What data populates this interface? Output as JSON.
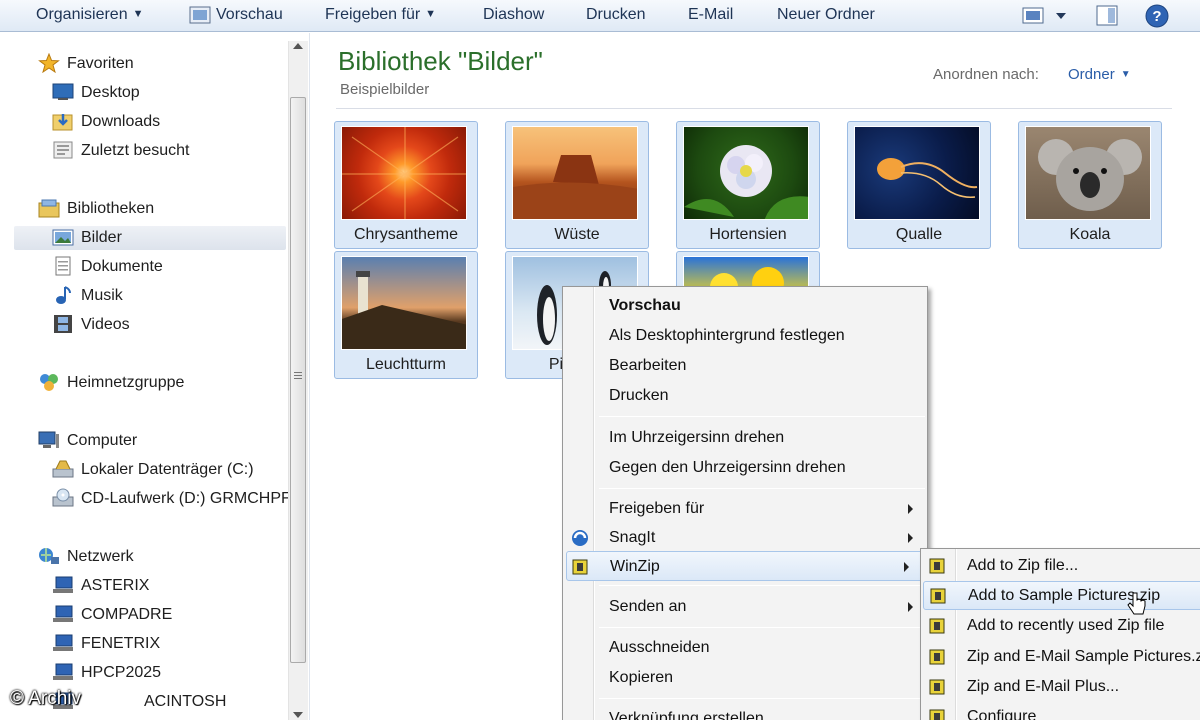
{
  "toolbar": {
    "organize": "Organisieren",
    "preview": "Vorschau",
    "share": "Freigeben für",
    "slideshow": "Diashow",
    "print": "Drucken",
    "email": "E-Mail",
    "new_folder": "Neuer Ordner"
  },
  "nav": {
    "favorites": "Favoriten",
    "desktop": "Desktop",
    "downloads": "Downloads",
    "recent": "Zuletzt besucht",
    "libraries": "Bibliotheken",
    "pictures": "Bilder",
    "documents": "Dokumente",
    "music": "Musik",
    "videos": "Videos",
    "homegroup": "Heimnetzgruppe",
    "computer": "Computer",
    "drive_c": "Lokaler Datenträger (C:)",
    "drive_d": "CD-Laufwerk (D:) GRMCHPF",
    "network": "Netzwerk",
    "net1": "ASTERIX",
    "net2": "COMPADRE",
    "net3": "FENETRIX",
    "net4": "HPCP2025",
    "net5": "ACINTOSH"
  },
  "content": {
    "title": "Bibliothek \"Bilder\"",
    "subtitle": "Beispielbilder",
    "arrange_label": "Anordnen nach:",
    "arrange_value": "Ordner",
    "items": [
      {
        "name": "Chrysantheme"
      },
      {
        "name": "Wüste"
      },
      {
        "name": "Hortensien"
      },
      {
        "name": "Qualle"
      },
      {
        "name": "Koala"
      },
      {
        "name": "Leuchtturm"
      },
      {
        "name": "Pi"
      },
      {
        "name": ""
      }
    ]
  },
  "context_menu": {
    "preview": "Vorschau",
    "set_desktop": "Als Desktophintergrund festlegen",
    "edit": "Bearbeiten",
    "print": "Drucken",
    "rotate_cw": "Im Uhrzeigersinn drehen",
    "rotate_ccw": "Gegen den Uhrzeigersinn drehen",
    "share": "Freigeben für",
    "snagit": "SnagIt",
    "winzip": "WinZip",
    "send_to": "Senden an",
    "cut": "Ausschneiden",
    "copy": "Kopieren",
    "shortcut": "Verknüpfung erstellen"
  },
  "winzip_menu": {
    "add": "Add to Zip file...",
    "add_named": "Add to Sample Pictures.zip",
    "add_recent": "Add to recently used Zip file",
    "zip_email": "Zip and E-Mail Sample Pictures.z",
    "zip_email_plus": "Zip and E-Mail Plus...",
    "configure": "Configure"
  },
  "watermark": "© Archiv",
  "colors": {
    "title_green": "#2b6f2b",
    "toolbar_text": "#1e3455",
    "selection_blue": "#dce9f8",
    "link_blue": "#2a5da8"
  }
}
